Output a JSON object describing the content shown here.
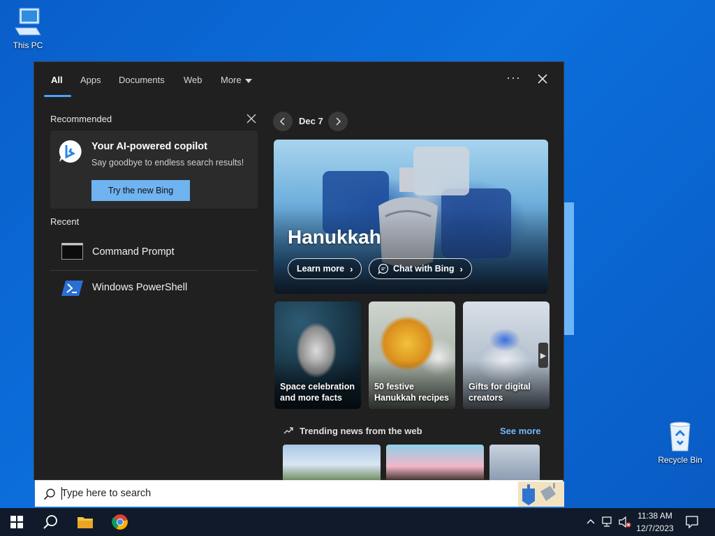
{
  "desktop": {
    "icons": [
      {
        "label": "This PC"
      },
      {
        "label": "Recycle Bin"
      }
    ]
  },
  "search_panel": {
    "tabs": [
      {
        "label": "All",
        "active": true
      },
      {
        "label": "Apps"
      },
      {
        "label": "Documents"
      },
      {
        "label": "Web"
      },
      {
        "label": "More"
      }
    ],
    "more_options_glyph": "···",
    "recommended": {
      "label": "Recommended",
      "card": {
        "title": "Your AI-powered copilot",
        "subtitle": "Say goodbye to endless search results!",
        "button": "Try the new Bing"
      }
    },
    "recent": {
      "label": "Recent",
      "items": [
        {
          "label": "Command Prompt",
          "icon": "cmd-icon"
        },
        {
          "label": "Windows PowerShell",
          "icon": "powershell-icon"
        }
      ]
    },
    "highlights": {
      "date": "Dec 7",
      "hero": {
        "title": "Hanukkah",
        "learn_more": "Learn more",
        "chat_with_bing": "Chat with Bing"
      },
      "cards": [
        {
          "caption": "Space celebration and more facts"
        },
        {
          "caption": "50 festive Hanukkah recipes"
        },
        {
          "caption": "Gifts for digital creators"
        }
      ],
      "trending": {
        "label": "Trending news from the web",
        "see_more": "See more"
      }
    }
  },
  "search_bar": {
    "placeholder": "Type here to search"
  },
  "taskbar": {
    "clock": {
      "time": "11:38 AM",
      "date": "12/7/2023"
    }
  },
  "colors": {
    "accent": "#4aa3ff",
    "panel_bg": "#202020",
    "taskbar_bg": "#101a2a",
    "button_blue": "#6fb3f0"
  }
}
